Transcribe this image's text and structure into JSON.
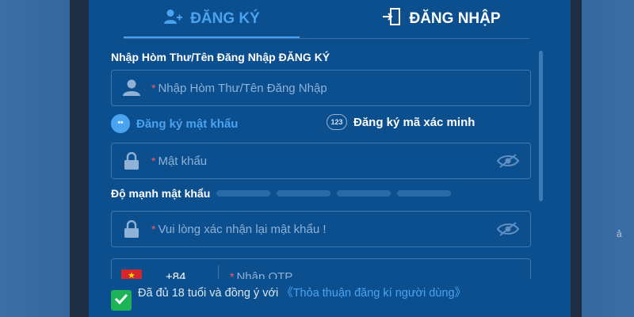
{
  "tabs": {
    "register_label": "ĐĂNG KÝ",
    "login_label": "ĐĂNG NHẬP"
  },
  "form": {
    "username_label": "Nhập Hòm Thư/Tên Đăng Nhập ĐĂNG KÝ",
    "username_placeholder": "Nhập Hòm Thư/Tên Đăng Nhập",
    "required_mark": "*",
    "option_password": "Đăng ký mật khẩu",
    "option_password_badge": "**",
    "option_code": "Đăng ký mã xác minh",
    "option_code_badge": "123",
    "password_placeholder": "Mật khẩu",
    "strength_label": "Độ mạnh mật khẩu",
    "strength_level": 0,
    "confirm_placeholder": "Vui lòng xác nhận lại mật khẩu !",
    "phone_dial_code": "+84",
    "phone_placeholder": "Nhập OTP"
  },
  "agreement": {
    "checked": true,
    "text": "Đã đủ 18 tuổi và đồng ý với ",
    "link": "《Thỏa thuận đăng kí người dùng》"
  },
  "side": {
    "right_glyph": "ả"
  },
  "colors": {
    "panel": "#0b4f8f",
    "accent": "#4aa3f0",
    "required": "#ff5a5a",
    "check": "#1fb357"
  },
  "icons": [
    "user-plus-icon",
    "login-door-icon",
    "user-icon",
    "lock-icon",
    "eye-slash-icon",
    "check-icon",
    "vietnam-flag-icon"
  ]
}
